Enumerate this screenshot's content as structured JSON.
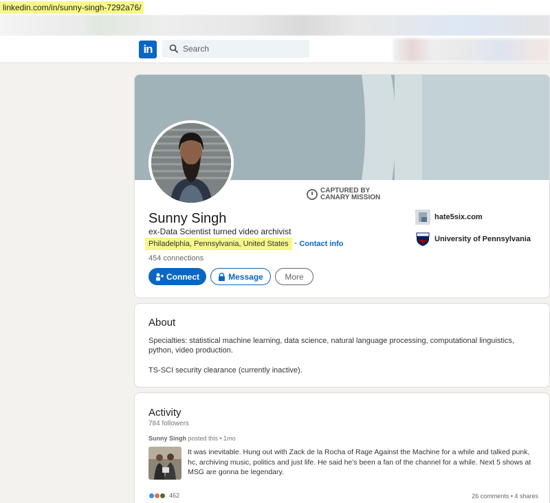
{
  "browser": {
    "url": "linkedin.com/in/sunny-singh-7292a76/"
  },
  "nav": {
    "logo_text": "in",
    "search_placeholder": "Search"
  },
  "profile": {
    "watermark_line1": "CAPTURED BY",
    "watermark_line2": "CANARY MISSION",
    "name": "Sunny Singh",
    "headline": "ex-Data Scientist turned video archivist",
    "location": "Philadelphia, Pennsylvania, United States",
    "contact_info": "· Contact info",
    "connections": "454 connections",
    "buttons": {
      "connect": "Connect",
      "message": "Message",
      "more": "More"
    },
    "side_items": [
      {
        "label": "hate5six.com",
        "icon": "website-icon"
      },
      {
        "label": "University of Pennsylvania",
        "icon": "upenn-shield-icon"
      }
    ]
  },
  "about": {
    "title": "About",
    "text1": "Specialties: statistical machine learning, data science, natural language processing, computational linguistics, python, video production.",
    "text2": "TS-SCI security clearance (currently inactive)."
  },
  "activity": {
    "title": "Activity",
    "followers": "784 followers",
    "author": "Sunny Singh",
    "posted_suffix": " posted this • 1mo",
    "post_text": "It was inevitable. Hung out with Zack de la Rocha of Rage Against the Machine for a while and talked punk, hc, archiving music, politics and just life. He said he's been a fan of the channel for a while. Next 5 shows at MSG are gonna be legendary.",
    "reaction_count": "462",
    "comments_shares": "26 comments • 4 shares"
  },
  "colors": {
    "accent": "#0a66c2",
    "highlight": "#f7f78a",
    "background": "#f3f2ef"
  }
}
